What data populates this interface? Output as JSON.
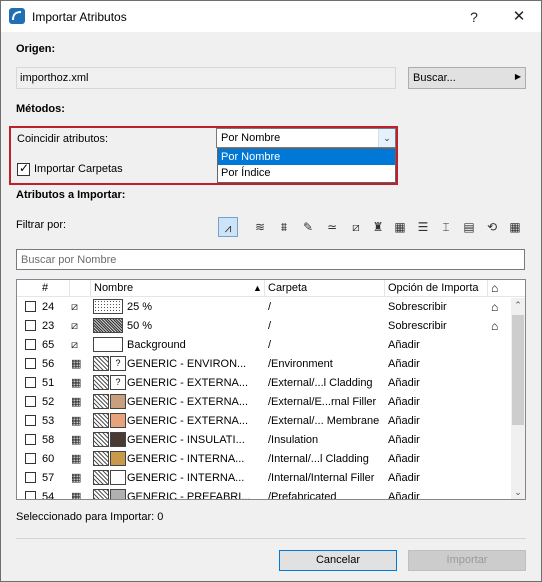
{
  "window": {
    "title": "Importar Atributos",
    "help_glyph": "?",
    "close_glyph": "✕"
  },
  "origin": {
    "heading": "Origen:",
    "file_value": "importhoz.xml",
    "browse_label": "Buscar..."
  },
  "methods": {
    "heading": "Métodos:",
    "match_label": "Coincidir atributos:",
    "match_selected": "Por Nombre",
    "match_options": [
      "Por Nombre",
      "Por Índice"
    ],
    "import_folders_label": "Importar Carpetas",
    "import_folders_checked": true
  },
  "attributes": {
    "heading": "Atributos a Importar:",
    "filter_label": "Filtrar por:",
    "filter_icons": [
      "all-types-icon",
      "layer-icon",
      "layer-combination-icon",
      "pen-set-icon",
      "line-type-icon",
      "fill-icon",
      "surface-icon",
      "building-material-icon",
      "composite-icon",
      "profile-icon",
      "zone-category-icon",
      "mep-system-icon",
      "markup-style-icon",
      "property-icon"
    ],
    "search_placeholder": "Buscar por Nombre"
  },
  "table": {
    "headers": {
      "num": "#",
      "name": "Nombre",
      "folder": "Carpeta",
      "option": "Opción de Importa"
    },
    "rows": [
      {
        "num": "24",
        "name": "25 %",
        "folder": "/",
        "option": "Sobrescribir",
        "type": "fill",
        "swatch": "dots",
        "merge": true
      },
      {
        "num": "23",
        "name": "50 %",
        "folder": "/",
        "option": "Sobrescribir",
        "type": "fill",
        "swatch": "dense",
        "merge": true
      },
      {
        "num": "65",
        "name": "Background",
        "folder": "/",
        "option": "Añadir",
        "type": "fill",
        "swatch": "white",
        "merge": false
      },
      {
        "num": "56",
        "name": "GENERIC - ENVIRON...",
        "folder": "/Environment",
        "option": "Añadir",
        "type": "material",
        "swatch": "q",
        "merge": false
      },
      {
        "num": "51",
        "name": "GENERIC - EXTERNA...",
        "folder": "/External/...l Cladding",
        "option": "Añadir",
        "type": "material",
        "swatch": "q",
        "merge": false
      },
      {
        "num": "52",
        "name": "GENERIC - EXTERNA...",
        "folder": "/External/E...rnal Filler",
        "option": "Añadir",
        "type": "material",
        "swatch": "#c8a07e",
        "merge": false
      },
      {
        "num": "53",
        "name": "GENERIC - EXTERNA...",
        "folder": "/External/... Membrane",
        "option": "Añadir",
        "type": "material",
        "swatch": "#e8a27c",
        "merge": false
      },
      {
        "num": "58",
        "name": "GENERIC - INSULATI...",
        "folder": "/Insulation",
        "option": "Añadir",
        "type": "material",
        "swatch": "#4a3a34",
        "merge": false
      },
      {
        "num": "60",
        "name": "GENERIC - INTERNA...",
        "folder": "/Internal/...l Cladding",
        "option": "Añadir",
        "type": "material",
        "swatch": "#c99a4a",
        "merge": false
      },
      {
        "num": "57",
        "name": "GENERIC - INTERNA...",
        "folder": "/Internal/Internal Filler",
        "option": "Añadir",
        "type": "material",
        "swatch": "#ffffff",
        "merge": false
      },
      {
        "num": "54",
        "name": "GENERIC - PREFABRI...",
        "folder": "/Prefabricated",
        "option": "Añadir",
        "type": "material",
        "swatch": "#b0b0b0",
        "merge": false
      }
    ]
  },
  "footer": {
    "selected_label": "Seleccionado para Importar: 0",
    "cancel_label": "Cancelar",
    "import_label": "Importar"
  },
  "colors": {
    "accent": "#0078d7",
    "highlight_border": "#c0202a"
  }
}
